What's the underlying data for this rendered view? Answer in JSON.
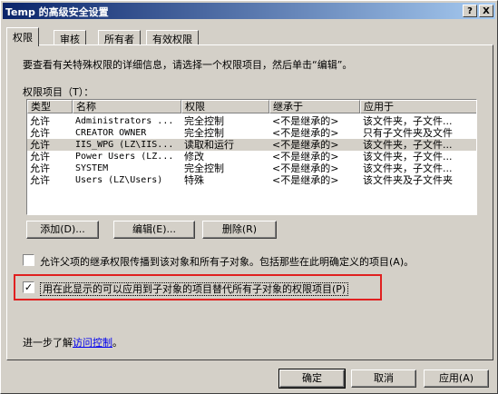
{
  "window": {
    "title": "Temp 的高级安全设置",
    "help_btn": "?",
    "close_btn": "X"
  },
  "tabs": [
    {
      "label": "权限"
    },
    {
      "label": "审核"
    },
    {
      "label": "所有者"
    },
    {
      "label": "有效权限"
    }
  ],
  "panel": {
    "instruction": "要查看有关特殊权限的详细信息，请选择一个权限项目，然后单击“编辑”。",
    "list_label": "权限项目（T）："
  },
  "permissions": {
    "columns": [
      "类型",
      "名称",
      "权限",
      "继承于",
      "应用于"
    ],
    "rows": [
      [
        "允许",
        "Administrators ...",
        "完全控制",
        "<不是继承的>",
        "该文件夹，子文件..."
      ],
      [
        "允许",
        "CREATOR OWNER",
        "完全控制",
        "<不是继承的>",
        "只有子文件夹及文件"
      ],
      [
        "允许",
        "IIS_WPG (LZ\\IIS...",
        "读取和运行",
        "<不是继承的>",
        "该文件夹，子文件..."
      ],
      [
        "允许",
        "Power Users (LZ...",
        "修改",
        "<不是继承的>",
        "该文件夹，子文件..."
      ],
      [
        "允许",
        "SYSTEM",
        "完全控制",
        "<不是继承的>",
        "该文件夹，子文件..."
      ],
      [
        "允许",
        "Users (LZ\\Users)",
        "特殊",
        "<不是继承的>",
        "该文件夹及子文件夹"
      ]
    ]
  },
  "buttons": {
    "add": "添加(D)...",
    "edit": "编辑(E)...",
    "remove": "删除(R)",
    "ok": "确定",
    "cancel": "取消",
    "apply": "应用(A)"
  },
  "options": {
    "inherit_label": "允许父项的继承权限传播到该对象和所有子对象。包括那些在此明确定义的项目(A)。",
    "inherit_checked": false,
    "replace_label": "用在此显示的可以应用到子对象的项目替代所有子对象的权限项目(P)",
    "replace_checked": true
  },
  "learn_more": {
    "prefix": "进一步了解",
    "link": "访问控制",
    "suffix": "。"
  },
  "colors": {
    "highlight_border": "#e02020",
    "title_start": "#0a246a"
  }
}
